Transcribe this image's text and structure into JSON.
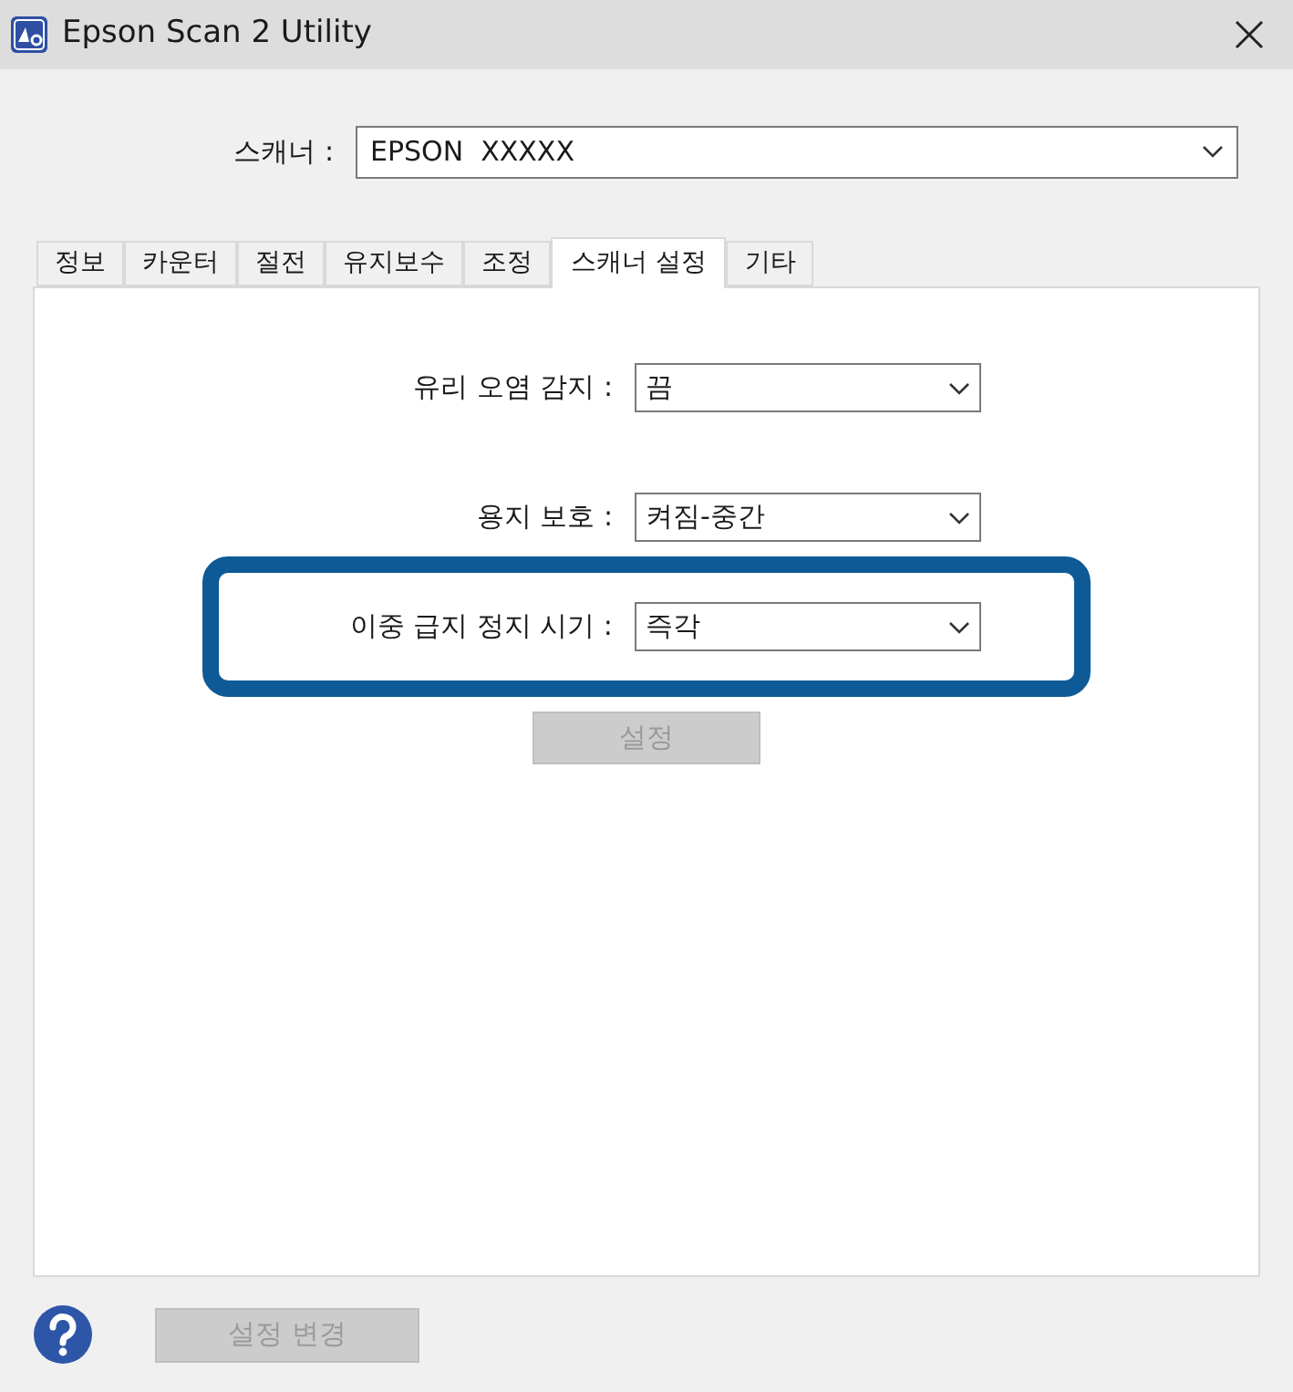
{
  "window": {
    "title": "Epson Scan 2 Utility"
  },
  "scanner": {
    "label": "스캐너 :",
    "value": "EPSON  XXXXX"
  },
  "tabs": [
    {
      "label": "정보",
      "selected": false
    },
    {
      "label": "카운터",
      "selected": false
    },
    {
      "label": "절전",
      "selected": false
    },
    {
      "label": "유지보수",
      "selected": false
    },
    {
      "label": "조정",
      "selected": false
    },
    {
      "label": "스캐너 설정",
      "selected": true
    },
    {
      "label": "기타",
      "selected": false
    }
  ],
  "settings": [
    {
      "label": "유리 오염 감지 :",
      "value": "끔",
      "highlighted": false
    },
    {
      "label": "용지 보호 :",
      "value": "켜짐-중간",
      "highlighted": false
    },
    {
      "label": "이중 급지 정지 시기 :",
      "value": "즉각",
      "highlighted": true
    }
  ],
  "apply_button": {
    "label": "설정",
    "disabled": true
  },
  "change_button": {
    "label": "설정 변경",
    "disabled": true
  }
}
